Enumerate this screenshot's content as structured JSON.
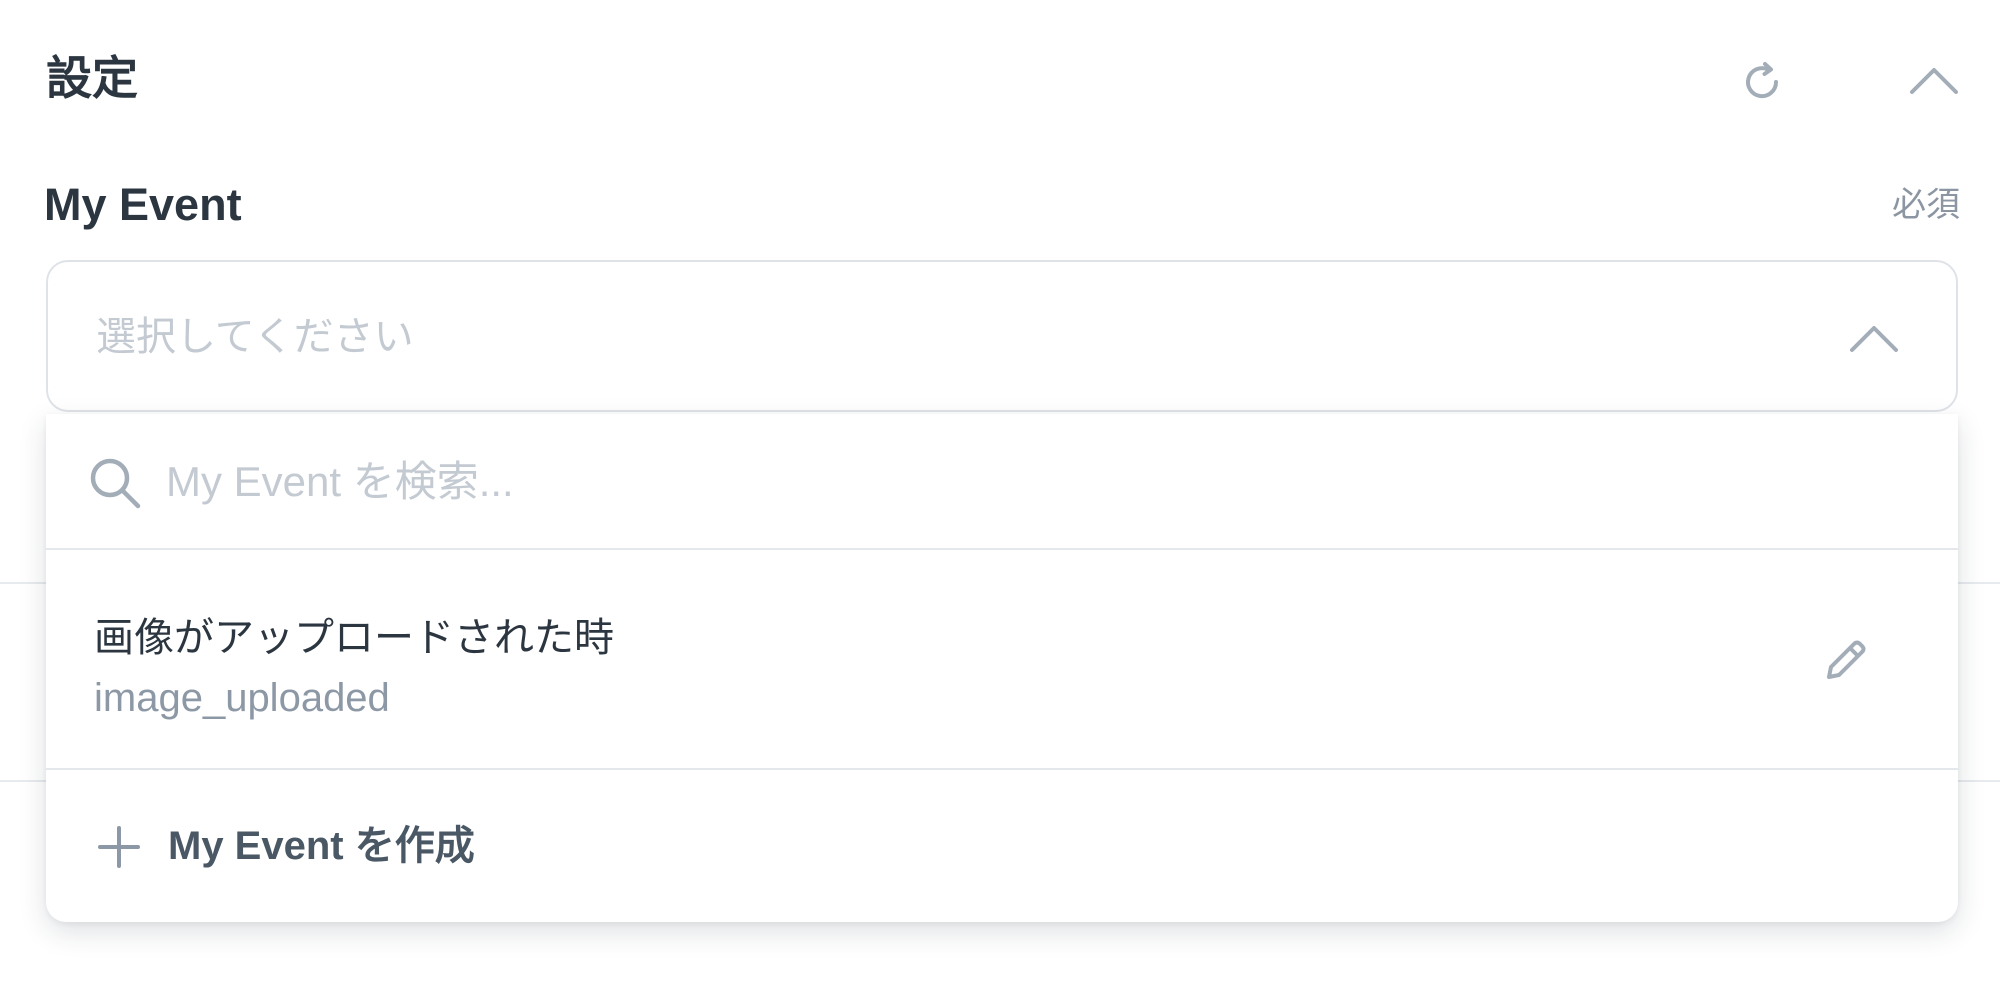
{
  "header": {
    "title": "設定",
    "refresh_icon": "refresh-icon",
    "collapse_icon": "chevron-up-icon"
  },
  "field": {
    "label": "My Event",
    "required": "必須",
    "placeholder": "選択してください",
    "chevron_icon": "chevron-up-icon"
  },
  "dropdown": {
    "search": {
      "icon": "search-icon",
      "placeholder": "My Event を検索...",
      "value": ""
    },
    "options": [
      {
        "title": "画像がアップロードされた時",
        "subtitle": "image_uploaded",
        "edit_icon": "pencil-icon"
      }
    ],
    "create": {
      "icon": "plus-icon",
      "label": "My Event を作成"
    }
  },
  "colors": {
    "text_primary": "#2c3640",
    "text_muted": "#8c98a5",
    "placeholder": "#c4cad2",
    "border": "#dfe3e8",
    "icon": "#a3adb8"
  }
}
